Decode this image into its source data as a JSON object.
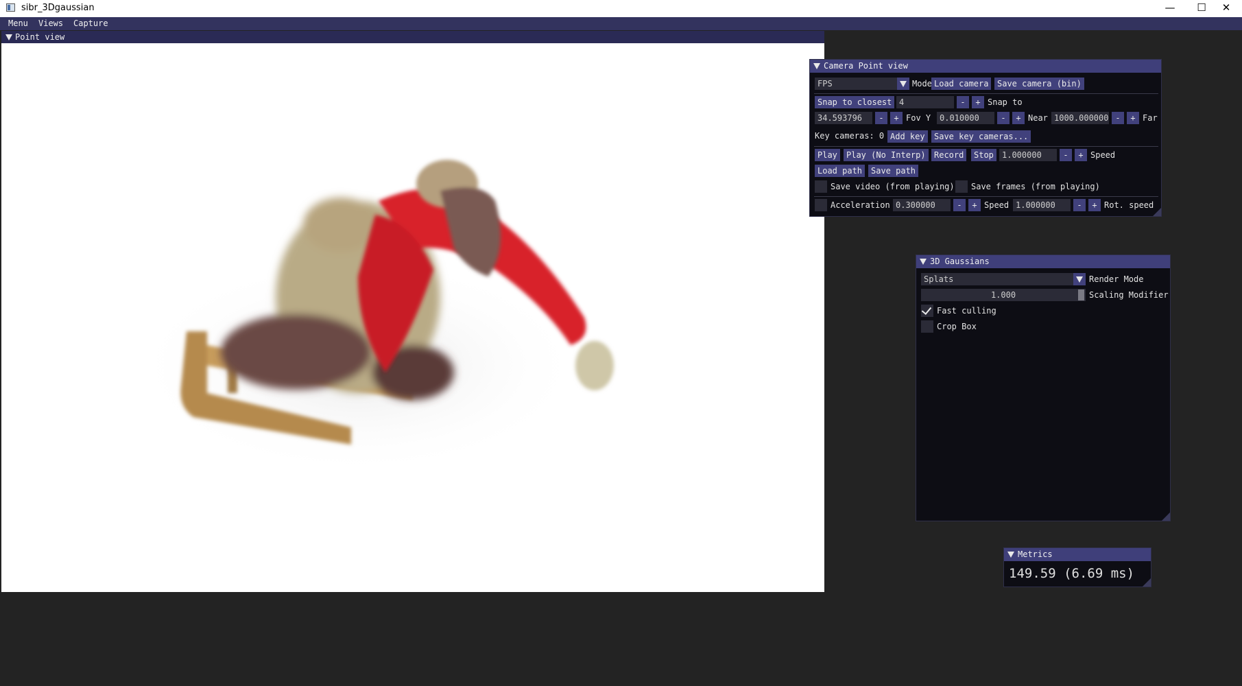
{
  "window": {
    "title": "sibr_3Dgaussian",
    "controls": {
      "minimize": "—",
      "maximize": "☐",
      "close": "✕"
    }
  },
  "menubar": {
    "items": [
      "Menu",
      "Views",
      "Capture"
    ]
  },
  "point_view": {
    "title": "Point view"
  },
  "camera_panel": {
    "title": "Camera Point view",
    "mode_value": "FPS",
    "mode_label": "Mode",
    "load_camera": "Load camera",
    "save_camera": "Save camera (bin)",
    "snap_closest": "Snap to closest",
    "snap_value": "4",
    "snap_to_label": "Snap to",
    "fov_value": "34.593796",
    "fov_label": "Fov Y",
    "near_value": "0.010000",
    "near_label": "Near",
    "far_value": "1000.000000",
    "far_label": "Far",
    "key_cameras_label": "Key cameras: 0",
    "add_key": "Add key",
    "save_key_cameras": "Save key cameras...",
    "play": "Play",
    "play_no_interp": "Play (No Interp)",
    "record": "Record",
    "stop": "Stop",
    "speed_value": "1.000000",
    "speed_label": "Speed",
    "load_path": "Load path",
    "save_path": "Save path",
    "save_video": "Save video (from playing)",
    "save_frames": "Save frames (from playing)",
    "acceleration_label": "Acceleration",
    "acceleration_value": "0.300000",
    "speed2_label": "Speed",
    "speed2_value": "1.000000",
    "rot_speed_label": "Rot. speed",
    "minus": "-",
    "plus": "+"
  },
  "gaussians_panel": {
    "title": "3D Gaussians",
    "render_mode_value": "Splats",
    "render_mode_label": "Render Mode",
    "scaling_value": "1.000",
    "scaling_label": "Scaling Modifier",
    "fast_culling_label": "Fast culling",
    "fast_culling_checked": true,
    "crop_box_label": "Crop Box",
    "crop_box_checked": false
  },
  "metrics_panel": {
    "title": "Metrics",
    "value": "149.59 (6.69 ms)"
  },
  "colors": {
    "menubar": "#33335e",
    "panel_header": "#3f3f7a",
    "button": "#41417c",
    "scene_red": "#d8242c",
    "scene_wood": "#b5894a"
  }
}
